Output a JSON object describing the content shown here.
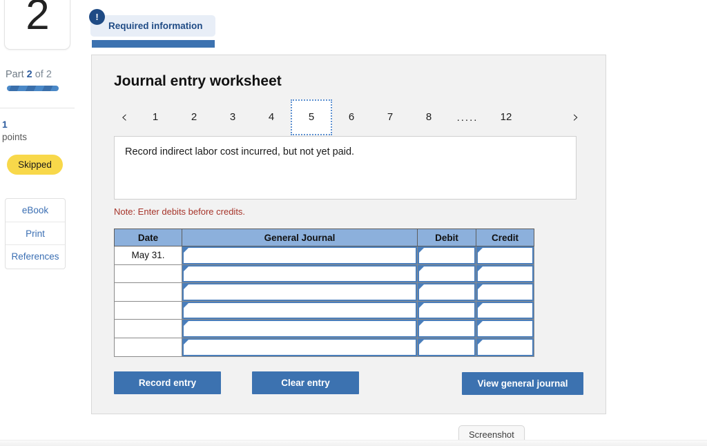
{
  "sidebar": {
    "question_number": "2",
    "part_label_prefix": "Part ",
    "part_current": "2",
    "part_of": " of 2",
    "points_value": "1",
    "points_word": "points",
    "status_badge": "Skipped",
    "tools": [
      {
        "label": "eBook"
      },
      {
        "label": "Print"
      },
      {
        "label": "References"
      }
    ]
  },
  "alert": {
    "icon": "!",
    "label": "Required information"
  },
  "panel": {
    "title": "Journal entry worksheet",
    "pagination": {
      "prev_icon": "‹",
      "next_icon": "›",
      "pages": [
        "1",
        "2",
        "3",
        "4",
        "5",
        "6",
        "7",
        "8"
      ],
      "ellipsis": ".....",
      "last_page": "12",
      "active_page": "5"
    },
    "question_text": "Record indirect labor cost incurred, but not yet paid.",
    "note": "Note: Enter debits before credits.",
    "table": {
      "headers": [
        "Date",
        "General Journal",
        "Debit",
        "Credit"
      ],
      "rows": [
        {
          "date": "May 31.",
          "general_journal": "",
          "debit": "",
          "credit": ""
        },
        {
          "date": "",
          "general_journal": "",
          "debit": "",
          "credit": ""
        },
        {
          "date": "",
          "general_journal": "",
          "debit": "",
          "credit": ""
        },
        {
          "date": "",
          "general_journal": "",
          "debit": "",
          "credit": ""
        },
        {
          "date": "",
          "general_journal": "",
          "debit": "",
          "credit": ""
        },
        {
          "date": "",
          "general_journal": "",
          "debit": "",
          "credit": ""
        }
      ]
    },
    "buttons": {
      "record": "Record entry",
      "clear": "Clear entry",
      "view": "View general journal"
    }
  },
  "tooltip": {
    "screenshot": "Screenshot"
  },
  "colors": {
    "accent_blue": "#3c72b0",
    "header_blue": "#8cb0dc",
    "field_border": "#4a7ebb",
    "link_blue": "#3b6fb3",
    "badge_yellow": "#f8d84a",
    "note_red": "#a6342a",
    "alert_bg": "#e8eef7",
    "alert_fg": "#1f4b85",
    "panel_bg": "#f2f2f2"
  }
}
